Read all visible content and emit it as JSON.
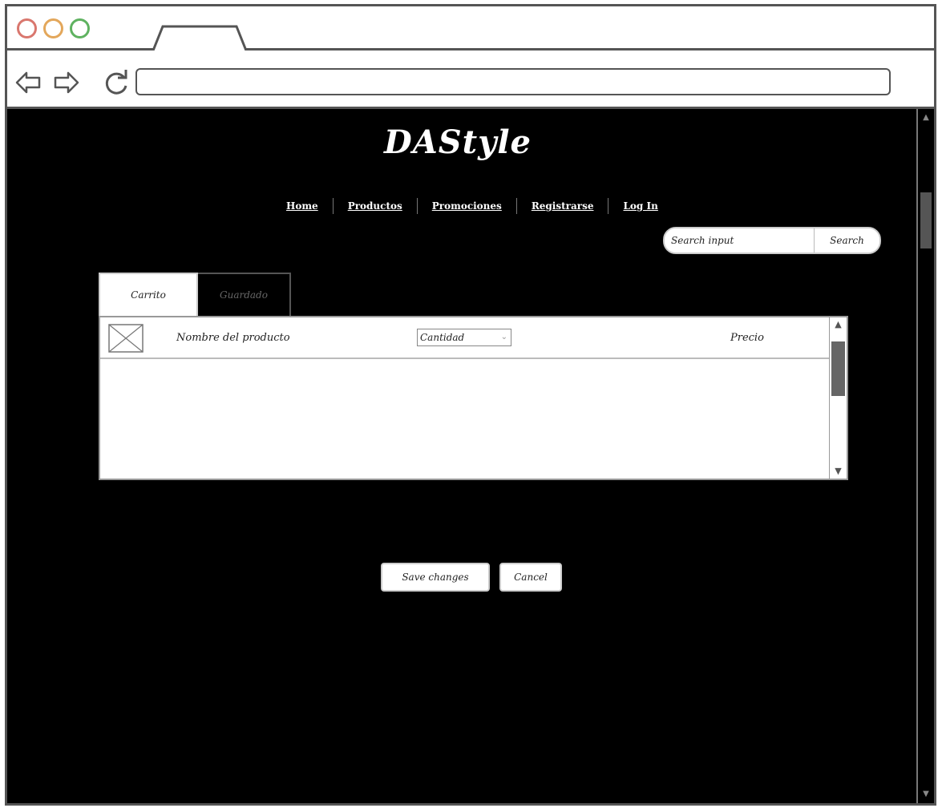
{
  "browser": {
    "url": ""
  },
  "header": {
    "logo": "DAStyle"
  },
  "nav": {
    "items": [
      "Home",
      "Productos",
      "Promociones",
      "Registrarse",
      "Log In"
    ]
  },
  "search": {
    "placeholder": "Search input",
    "button_label": "Search"
  },
  "tabs": [
    {
      "label": "Carrito",
      "active": true
    },
    {
      "label": "Guardado",
      "active": false
    }
  ],
  "table": {
    "row": {
      "product_name": "Nombre del producto",
      "quantity_selected": "Cantidad",
      "price": "Precio"
    }
  },
  "actions": {
    "save_label": "Save changes",
    "cancel_label": "Cancel"
  },
  "icons": {
    "close_dot_color": "#d9776e",
    "minimize_dot_color": "#e3a75b",
    "maximize_dot_color": "#5fb260"
  }
}
